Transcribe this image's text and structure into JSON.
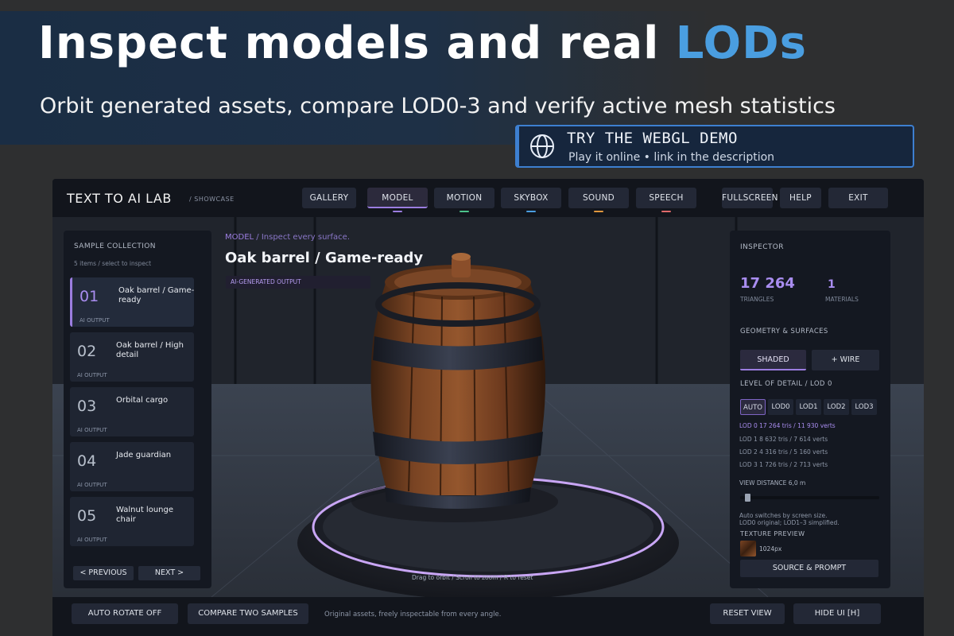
{
  "promo": {
    "title_main": "Inspect models and real ",
    "title_accent": "LODs",
    "subtitle": "Orbit generated assets, compare LOD0-3 and verify active mesh statistics",
    "demo_title": "TRY THE WEBGL DEMO",
    "demo_sub": "Play it online  •  link in the description",
    "accent_color": "#4a9ee0"
  },
  "topbar": {
    "brand": "TEXT TO AI LAB",
    "brand_sub": "/  SHOWCASE",
    "tabs": [
      "GALLERY",
      "MODEL",
      "MOTION",
      "SKYBOX",
      "SOUND",
      "SPEECH"
    ],
    "active_tab": "MODEL",
    "actions": [
      "FULLSCREEN",
      "HELP",
      "EXIT"
    ]
  },
  "samples": {
    "heading": "SAMPLE COLLECTION",
    "meta": "5 items  /  select to inspect",
    "items": [
      {
        "num": "01",
        "name": "Oak barrel / Game-ready",
        "tag": "AI OUTPUT"
      },
      {
        "num": "02",
        "name": "Oak barrel / High detail",
        "tag": "AI OUTPUT"
      },
      {
        "num": "03",
        "name": "Orbital cargo",
        "tag": "AI OUTPUT"
      },
      {
        "num": "04",
        "name": "Jade guardian",
        "tag": "AI OUTPUT"
      },
      {
        "num": "05",
        "name": "Walnut lounge chair",
        "tag": "AI OUTPUT"
      }
    ],
    "prev": "<  PREVIOUS",
    "next": "NEXT  >"
  },
  "viewport": {
    "breadcrumb_section": "MODEL",
    "breadcrumb_rest": "/  Inspect every surface.",
    "model_title": "Oak barrel / Game-ready",
    "badge": "AI-GENERATED OUTPUT",
    "hint": "Drag to orbit  /  Scroll to zoom  /  R to reset"
  },
  "inspector": {
    "heading": "INSPECTOR",
    "triangles_value": "17 264",
    "triangles_label": "TRIANGLES",
    "materials_value": "1",
    "materials_label": "MATERIALS",
    "geometry_heading": "GEOMETRY & SURFACES",
    "shaded": "SHADED",
    "wire": "+ WIRE",
    "lod_heading": "LEVEL OF DETAIL  /  LOD 0",
    "lod_buttons": [
      "AUTO",
      "LOD0",
      "LOD1",
      "LOD2",
      "LOD3"
    ],
    "lod_rows": [
      "LOD 0   17 264 tris  /  11 930 verts",
      "LOD 1   8 632 tris  /  7 614 verts",
      "LOD 2   4 316 tris  /  5 160 verts",
      "LOD 3   1 726 tris  /  2 713 verts"
    ],
    "view_distance": "VIEW DISTANCE   6,0 m",
    "note1": "Auto switches by screen size.",
    "note2": "LOD0 original; LOD1–3 simplified.",
    "texture_heading": "TEXTURE PREVIEW",
    "texture_size": "1024px",
    "source_button": "SOURCE & PROMPT"
  },
  "bottombar": {
    "auto_rotate": "AUTO ROTATE   OFF",
    "compare": "COMPARE TWO SAMPLES",
    "caption": "Original assets, freely inspectable from every angle.",
    "reset": "RESET VIEW",
    "hide": "HIDE UI  [H]"
  }
}
